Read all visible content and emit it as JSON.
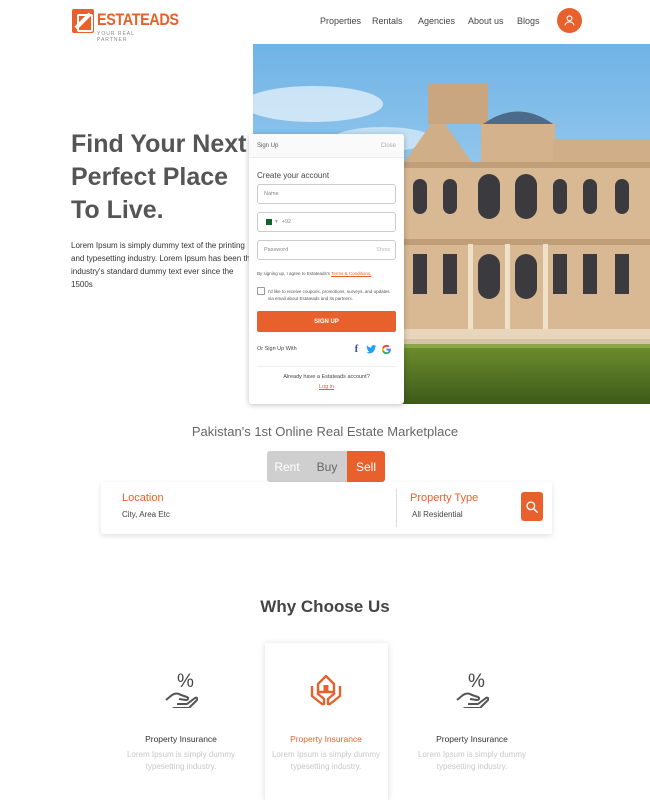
{
  "brand": {
    "name": "ESTATEADS",
    "tagline": "YOUR REAL PARTNER"
  },
  "nav": {
    "items": [
      "Properties",
      "Rentals",
      "Agencies",
      "About us",
      "Blogs"
    ]
  },
  "hero": {
    "title": "Find Your Next Perfect Place To Live.",
    "description": "Lorem Ipsum is simply dummy text of the printing and typesetting industry. Lorem Ipsum has been the industry's standard dummy text ever since the 1500s"
  },
  "signup": {
    "tab": "Sign Up",
    "close": "Close",
    "heading": "Create your account",
    "name_placeholder": "Name",
    "phone_code": "+92",
    "password_placeholder": "Password",
    "show": "Show",
    "terms_prefix": "By signing up, I agree to Estateads's",
    "terms_link": "Terms & Conditions.",
    "promo_text": "I'd like to receive coupons, promotions, surveys, and updates via email about Estateads and its partners.",
    "button": "SIGN UP",
    "or_text": "Or Sign Up With",
    "social": [
      "facebook",
      "twitter",
      "google"
    ],
    "already": "Already have a Estateads account?",
    "login": "Log in"
  },
  "market": {
    "tagline": "Pakistan's 1st Online Real Estate Marketplace",
    "tabs": [
      "Rent",
      "Buy",
      "Sell"
    ],
    "active_tab": "Sell",
    "location_label": "Location",
    "location_value": "City, Area Etc",
    "type_label": "Property Type",
    "type_value": "All Residential"
  },
  "why": {
    "title": "Why Choose Us",
    "features": [
      {
        "icon": "percent-hand-icon",
        "title": "Property Insurance",
        "desc": "Lorem Ipsum is simply dummy typesetting industry."
      },
      {
        "icon": "house-hands-icon",
        "title": "Property Insurance",
        "desc": "Lorem Ipsum is simply dummy typesetting industry."
      },
      {
        "icon": "percent-hand-icon",
        "title": "Property Insurance",
        "desc": "Lorem Ipsum is simply dummy typesetting industry."
      }
    ]
  },
  "colors": {
    "accent": "#e8612c",
    "text": "#333333",
    "muted": "#c8c8c8"
  }
}
